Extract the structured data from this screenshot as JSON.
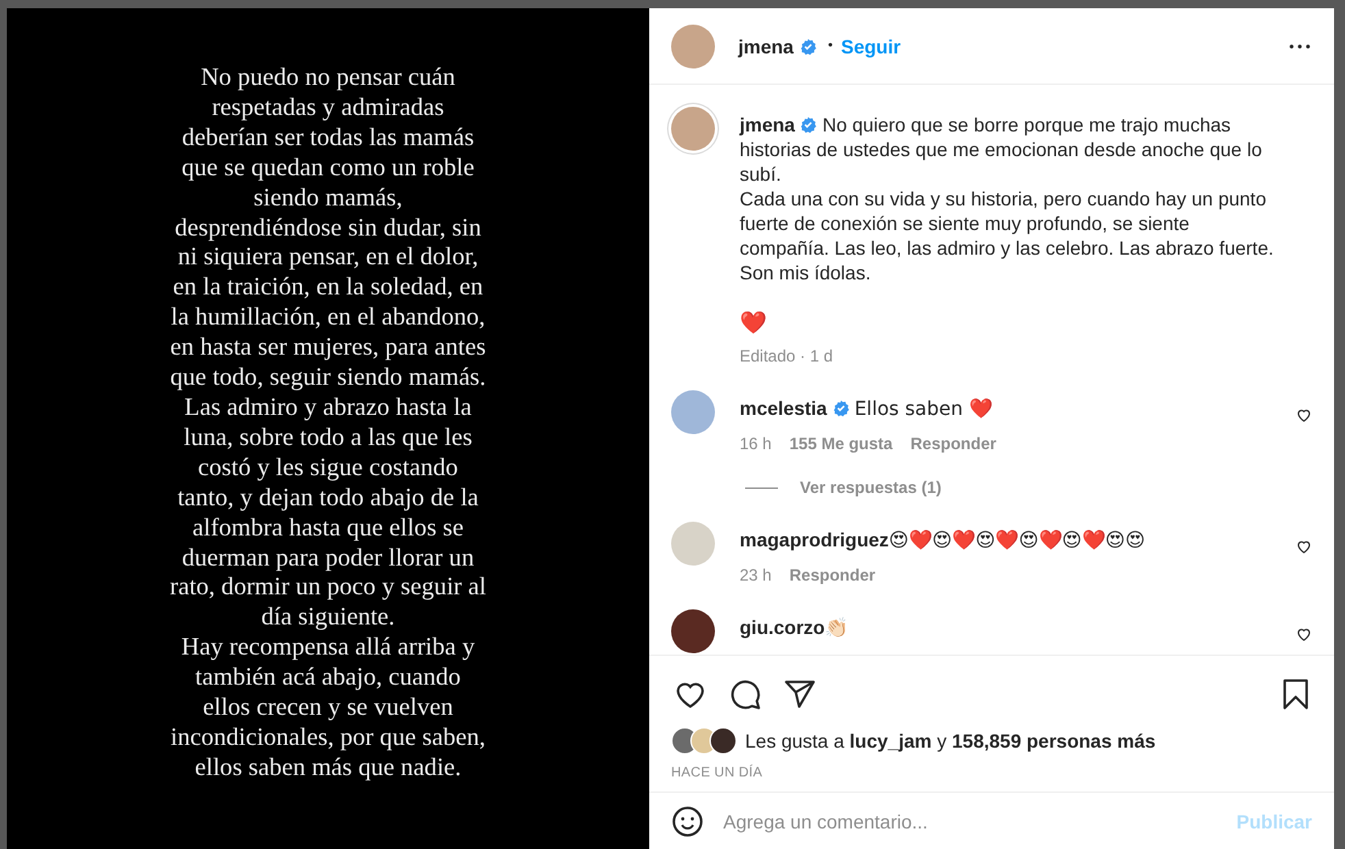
{
  "post_image": {
    "paragraphs": [
      "No puedo no pensar cuán respetadas y admiradas deberían ser todas las mamás que se quedan como un roble siendo mamás, desprendiéndose sin dudar, sin ni siquiera pensar, en el dolor, en la traición, en la soledad, en la humillación, en el abandono, en hasta ser mujeres, para antes que todo, seguir siendo mamás.",
      "Las admiro y abrazo hasta la luna, sobre todo a las que les costó y les sigue costando tanto, y dejan todo abajo de la alfombra hasta que ellos se duerman para poder llorar un rato, dormir un poco y seguir al día siguiente.",
      "Hay recompensa allá arriba y también acá abajo, cuando ellos crecen y se vuelven incondicionales, por que saben, ellos saben más que nadie."
    ]
  },
  "header": {
    "username": "jmena",
    "verified": true,
    "separator": "•",
    "follow": "Seguir"
  },
  "caption": {
    "username": "jmena",
    "verified": true,
    "text": "No quiero que se borre porque me trajo muchas historias de ustedes que me emocionan desde anoche que lo subí.\nCada una con su vida y su historia, pero cuando hay un punto fuerte de conexión se siente muy profundo, se siente compañía. Las leo, las admiro y las celebro. Las abrazo fuerte. Son mis ídolas.",
    "emoji": "❤️",
    "meta": "Editado · 1 d"
  },
  "comments": [
    {
      "username": "mcelestia",
      "verified": true,
      "text": "Ellos saben ❤️",
      "time": "16 h",
      "likes": "155 Me gusta",
      "reply": "Responder",
      "view_replies": "Ver respuestas (1)"
    },
    {
      "username": "magaprodriguez",
      "verified": false,
      "text": "😍❤️😍❤️😍❤️😍❤️😍❤️😍😍",
      "time": "23 h",
      "reply": "Responder"
    },
    {
      "username": "giu.corzo",
      "verified": false,
      "text": "👏🏻"
    }
  ],
  "likes": "Les gusta a **lucy_jam** y **158,859 personas más**",
  "timestamp": "HACE UN DÍA",
  "comment_box": {
    "placeholder": "Agrega un comentario...",
    "post": "Publicar",
    "disabled": true
  }
}
